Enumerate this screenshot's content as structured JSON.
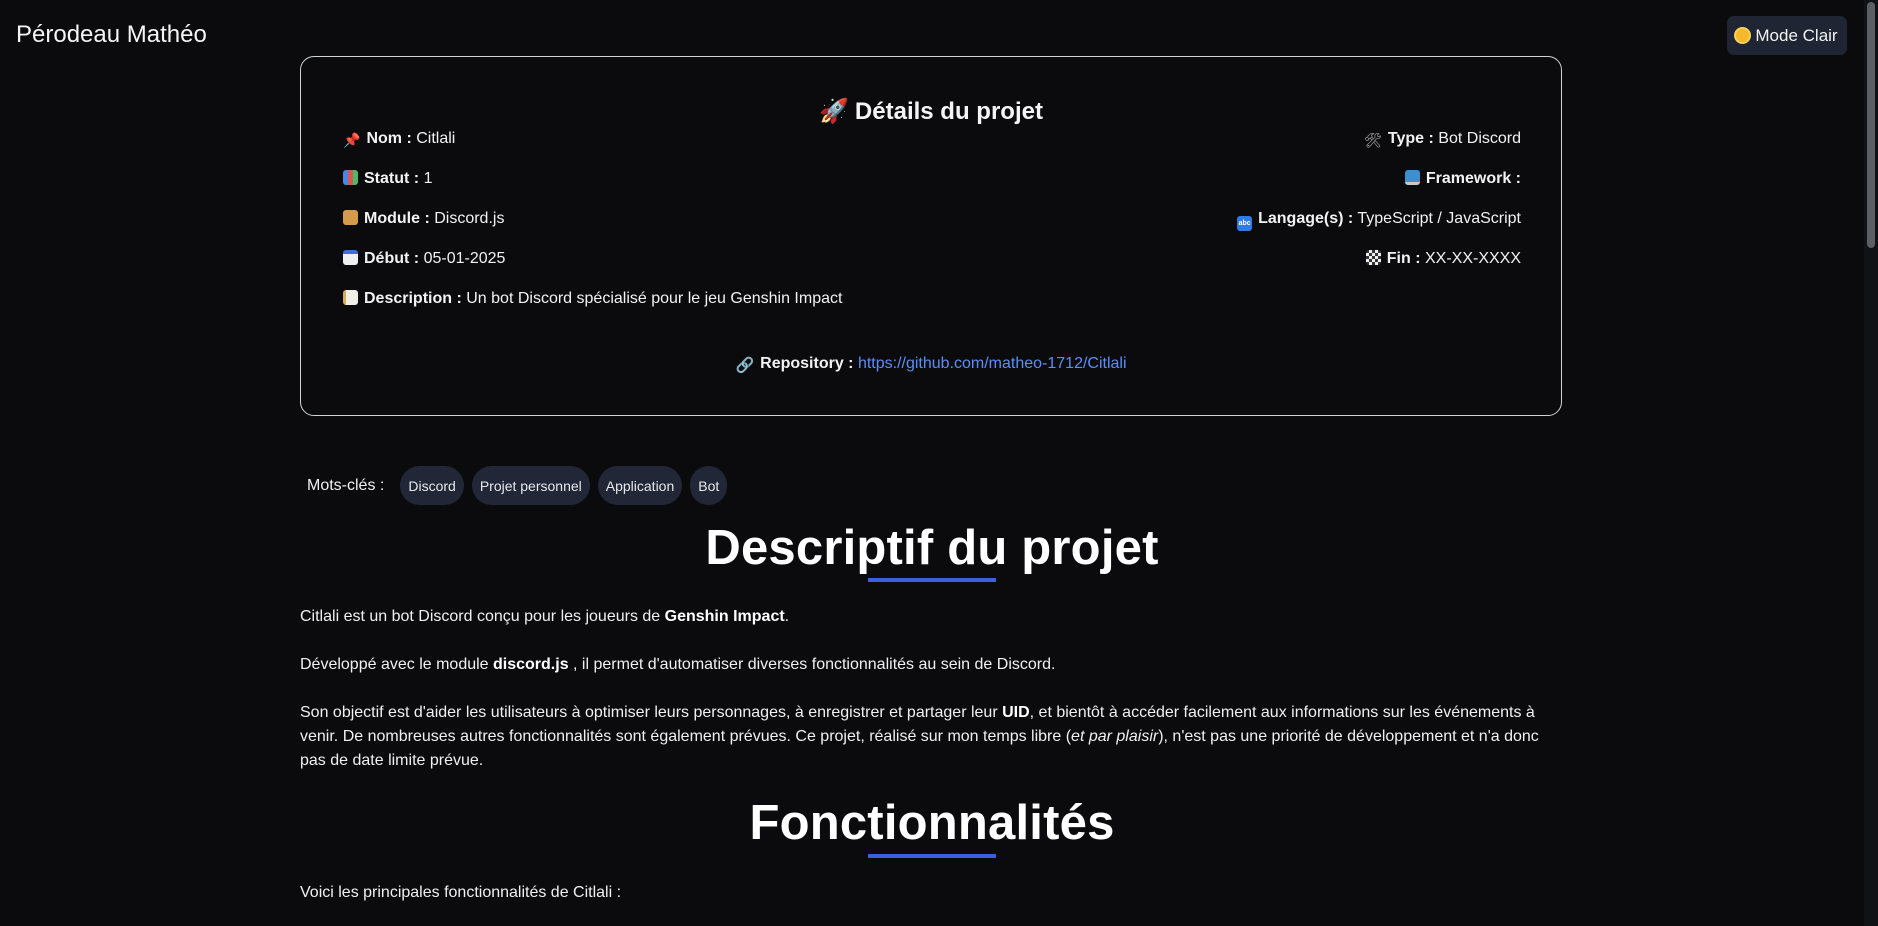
{
  "header": {
    "site_name": "Pérodeau Mathéo",
    "theme_button_label": "Mode Clair",
    "theme_icon": "sun-icon"
  },
  "project_card": {
    "title": "Détails du projet",
    "title_icon": "rocket-icon",
    "name": {
      "label": "Nom :",
      "value": "Citlali",
      "icon": "pin-icon"
    },
    "status": {
      "label": "Statut :",
      "value": "1",
      "icon": "chart-icon"
    },
    "module": {
      "label": "Module :",
      "value": "Discord.js",
      "icon": "package-icon"
    },
    "start": {
      "label": "Début :",
      "value": "05-01-2025",
      "icon": "calendar-icon"
    },
    "description": {
      "label": "Description :",
      "value": "Un bot Discord spécialisé pour le jeu Genshin Impact",
      "icon": "memo-icon"
    },
    "type": {
      "label": "Type :",
      "value": "Bot Discord",
      "icon": "tools-icon"
    },
    "framework": {
      "label": "Framework :",
      "value": "",
      "icon": "laptop-icon"
    },
    "languages": {
      "label": "Langage(s) :",
      "value": "TypeScript / JavaScript",
      "icon": "abc-icon"
    },
    "end": {
      "label": "Fin :",
      "value": "XX-XX-XXXX",
      "icon": "flag-icon"
    },
    "repository": {
      "label": "Repository :",
      "value": "https://github.com/matheo-1712/Citlali",
      "icon": "link-icon",
      "link_color": "#5b8ef7"
    }
  },
  "keywords": {
    "label": "Mots-clés :",
    "tags": [
      "Discord",
      "Projet personnel",
      "Application",
      "Bot"
    ]
  },
  "description_section": {
    "heading": "Descriptif du projet",
    "p1_a": "Citlali est un bot Discord conçu pour les joueurs de ",
    "p1_b": "Genshin Impact",
    "p1_c": ".",
    "p2_a": "Développé avec le module ",
    "p2_b": "discord.js",
    "p2_c": " , il permet d'automatiser diverses fonctionnalités au sein de Discord.",
    "p3_a": "Son objectif est d'aider les utilisateurs à optimiser leurs personnages, à enregistrer et partager leur ",
    "p3_b": "UID",
    "p3_c": ", et bientôt à accéder facilement aux informations sur les événements à venir. De nombreuses autres fonctionnalités sont également prévues. Ce projet, réalisé sur mon temps libre (",
    "p3_d": "et par plaisir",
    "p3_e": "), n'est pas une priorité de développement et n'a donc pas de date limite prévue."
  },
  "features_section": {
    "heading": "Fonctionnalités",
    "intro": "Voici les principales fonctionnalités de Citlali :"
  },
  "colors": {
    "background": "#0b0b0d",
    "accent": "#3b5fe0",
    "tag_bg": "#212736",
    "button_bg": "#1f2533"
  }
}
